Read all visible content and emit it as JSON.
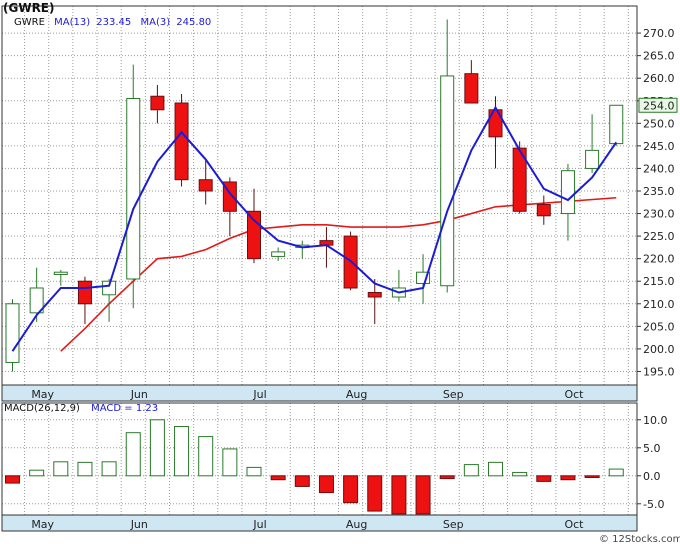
{
  "title": "(GWRE)",
  "watermark": "© 12Stocks.com",
  "chart_data": {
    "type": "candlestick",
    "price_panel": {
      "ylim": [
        192,
        276
      ],
      "yticks": [
        195,
        200,
        205,
        210,
        215,
        220,
        225,
        230,
        235,
        240,
        245,
        250,
        255,
        260,
        265,
        270
      ],
      "ytick_labels": [
        "195.0",
        "200.0",
        "205.0",
        "210.0",
        "215.0",
        "220.0",
        "225.0",
        "230.0",
        "235.0",
        "240.0",
        "245.0",
        "250.0",
        "255.0",
        "260.0",
        "265.0",
        "270.0"
      ],
      "legend": {
        "symbol": "GWRE",
        "ma13_label": "MA(13)",
        "ma13_value": "233.45",
        "ma3_label": "MA(3)",
        "ma3_value": "245.80"
      },
      "last_price_label": "254.0",
      "last_price": 254.0,
      "candles": [
        {
          "o": 197.0,
          "h": 211.0,
          "l": 195.0,
          "c": 210.0
        },
        {
          "o": 208.0,
          "h": 218.0,
          "l": 206.0,
          "c": 213.5
        },
        {
          "o": 216.5,
          "h": 217.5,
          "l": 214.0,
          "c": 217.0
        },
        {
          "o": 215.0,
          "h": 216.0,
          "l": 205.5,
          "c": 210.0
        },
        {
          "o": 212.0,
          "h": 215.5,
          "l": 206.0,
          "c": 215.0
        },
        {
          "o": 215.5,
          "h": 263.0,
          "l": 209.0,
          "c": 255.5
        },
        {
          "o": 256.0,
          "h": 258.5,
          "l": 250.0,
          "c": 253.0
        },
        {
          "o": 254.5,
          "h": 256.5,
          "l": 236.0,
          "c": 237.5
        },
        {
          "o": 237.5,
          "h": 242.0,
          "l": 232.0,
          "c": 235.0
        },
        {
          "o": 237.0,
          "h": 238.0,
          "l": 225.0,
          "c": 230.5
        },
        {
          "o": 230.5,
          "h": 235.5,
          "l": 219.0,
          "c": 220.0
        },
        {
          "o": 220.5,
          "h": 222.5,
          "l": 219.5,
          "c": 221.5
        },
        {
          "o": 222.5,
          "h": 224.0,
          "l": 220.0,
          "c": 223.0
        },
        {
          "o": 224.0,
          "h": 227.0,
          "l": 218.0,
          "c": 223.0
        },
        {
          "o": 225.0,
          "h": 226.0,
          "l": 213.0,
          "c": 213.5
        },
        {
          "o": 212.5,
          "h": 215.5,
          "l": 205.5,
          "c": 211.5
        },
        {
          "o": 211.5,
          "h": 217.5,
          "l": 210.5,
          "c": 213.5
        },
        {
          "o": 214.5,
          "h": 221.0,
          "l": 210.0,
          "c": 217.0
        },
        {
          "o": 214.0,
          "h": 273.0,
          "l": 212.5,
          "c": 260.5
        },
        {
          "o": 261.0,
          "h": 264.0,
          "l": 255.0,
          "c": 254.5
        },
        {
          "o": 253.0,
          "h": 256.0,
          "l": 240.0,
          "c": 247.0
        },
        {
          "o": 244.5,
          "h": 246.0,
          "l": 230.0,
          "c": 230.5
        },
        {
          "o": 232.0,
          "h": 234.0,
          "l": 227.5,
          "c": 229.5
        },
        {
          "o": 230.0,
          "h": 241.0,
          "l": 224.0,
          "c": 239.5
        },
        {
          "o": 240.0,
          "h": 252.0,
          "l": 239.0,
          "c": 244.0
        },
        {
          "o": 245.5,
          "h": 254.0,
          "l": 245.0,
          "c": 254.0
        }
      ],
      "ma13": [
        199.5,
        204.5,
        210.0,
        215.0,
        220.0,
        220.5,
        222.0,
        224.5,
        226.5,
        227.0,
        227.5,
        227.5,
        227.0,
        227.0,
        227.0,
        227.5,
        228.5,
        230.0,
        231.5,
        233.5
      ],
      "ma13_x": [
        2,
        3,
        4,
        5,
        6,
        7,
        8,
        9,
        10,
        11,
        12,
        13,
        14,
        15,
        16,
        17,
        18,
        19,
        20,
        25
      ],
      "ma3_x": [
        0,
        1,
        2,
        3,
        4,
        5,
        6,
        7,
        8,
        9,
        10,
        11,
        12,
        13,
        14,
        15,
        16,
        17,
        18,
        19,
        20,
        21,
        22,
        23,
        24,
        25
      ],
      "ma3": [
        199.5,
        207.5,
        213.5,
        213.5,
        214.0,
        231.0,
        241.5,
        248.0,
        242.0,
        234.5,
        228.5,
        224.0,
        222.5,
        223.0,
        219.5,
        214.5,
        212.5,
        213.5,
        230.5,
        244.0,
        253.5,
        244.0,
        235.5,
        233.0,
        238.0,
        245.8
      ]
    },
    "macd_panel": {
      "legend": {
        "label": "MACD(26,12,9)",
        "value_label": "MACD = 1.23"
      },
      "ylim": [
        -7.0,
        13.0
      ],
      "yticks": [
        -5.0,
        0.0,
        5.0,
        10.0
      ],
      "ytick_labels": [
        "-5.0",
        "0.0",
        "5.0",
        "10.0"
      ],
      "values": [
        -1.3,
        1.0,
        2.5,
        2.4,
        2.5,
        7.7,
        10.0,
        8.8,
        7.0,
        4.8,
        1.5,
        -0.7,
        -1.9,
        -3.0,
        -4.8,
        -6.3,
        -6.8,
        -6.8,
        -0.5,
        2.0,
        2.4,
        0.6,
        -1.0,
        -0.7,
        -0.3,
        1.2
      ]
    },
    "x_axis": {
      "month_labels": [
        "May",
        "Jun",
        "Jul",
        "Aug",
        "Sep",
        "Oct"
      ],
      "month_positions": [
        1.25,
        5.25,
        10.25,
        14.25,
        18.25,
        23.25
      ]
    }
  }
}
